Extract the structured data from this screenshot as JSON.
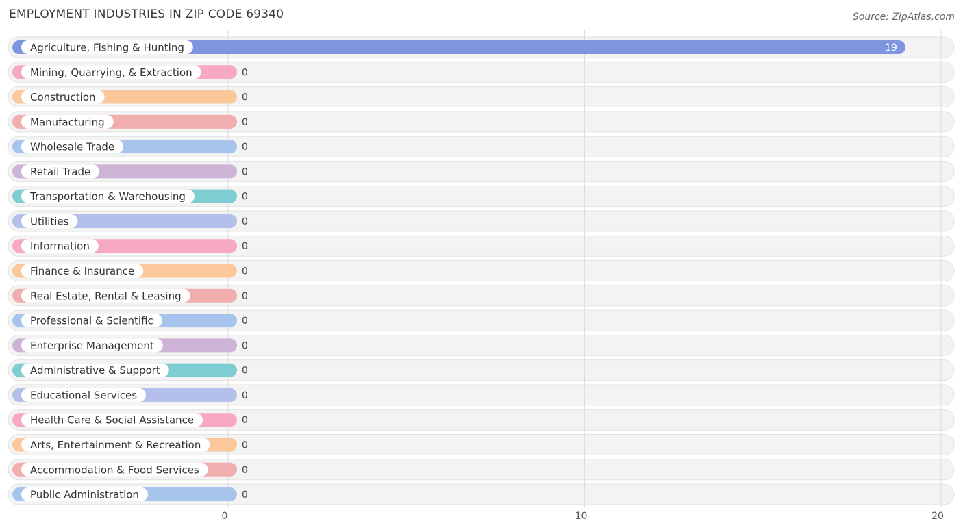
{
  "title": "EMPLOYMENT INDUSTRIES IN ZIP CODE 69340",
  "source": "Source: ZipAtlas.com",
  "chart_data": {
    "type": "bar",
    "orientation": "horizontal",
    "title": "EMPLOYMENT INDUSTRIES IN ZIP CODE 69340",
    "xlabel": "",
    "ylabel": "",
    "xlim": [
      0,
      20
    ],
    "x_ticks": [
      0,
      10,
      20
    ],
    "grid": true,
    "categories": [
      "Agriculture, Fishing & Hunting",
      "Mining, Quarrying, & Extraction",
      "Construction",
      "Manufacturing",
      "Wholesale Trade",
      "Retail Trade",
      "Transportation & Warehousing",
      "Utilities",
      "Information",
      "Finance & Insurance",
      "Real Estate, Rental & Leasing",
      "Professional & Scientific",
      "Enterprise Management",
      "Administrative & Support",
      "Educational Services",
      "Health Care & Social Assistance",
      "Arts, Entertainment & Recreation",
      "Accommodation & Food Services",
      "Public Administration"
    ],
    "values": [
      19,
      0,
      0,
      0,
      0,
      0,
      0,
      0,
      0,
      0,
      0,
      0,
      0,
      0,
      0,
      0,
      0,
      0,
      0
    ],
    "colors": [
      "#7f96de",
      "#f7a8c2",
      "#fdc79c",
      "#f0aeae",
      "#a7c5ec",
      "#cdb3d6",
      "#7ecdd2",
      "#b4bfec",
      "#f7a8c2",
      "#fdc79c",
      "#f0aeae",
      "#a7c5ec",
      "#cdb3d6",
      "#7ecdd2",
      "#b4bfec",
      "#f7a8c2",
      "#fdc79c",
      "#f0aeae",
      "#a7c5ec"
    ]
  }
}
